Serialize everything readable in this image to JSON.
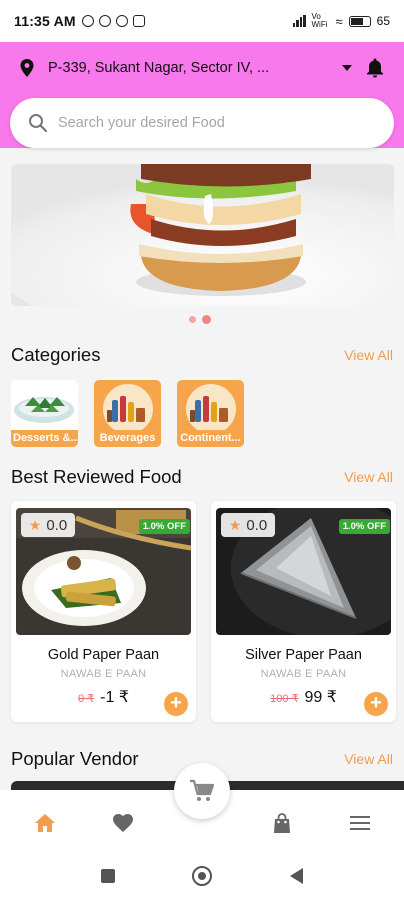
{
  "status_bar": {
    "time": "11:35 AM",
    "network": "Vo WiFi",
    "battery": "65"
  },
  "header": {
    "address": "P-339, Sukant Nagar, Sector IV, ...",
    "search_placeholder": "Search your desired  Food",
    "background_color": "#f879ec"
  },
  "banner": {
    "slide_count": 2,
    "active_index": 1
  },
  "categories": {
    "title": "Categories",
    "view_all": "View All",
    "items": [
      {
        "label": "Desserts &...",
        "icon": "dessert-plate-icon"
      },
      {
        "label": "Beverages",
        "icon": "bottles-icon"
      },
      {
        "label": "Continent...",
        "icon": "bottles-icon"
      }
    ]
  },
  "best_reviewed": {
    "title": "Best Reviewed Food",
    "view_all": "View All",
    "items": [
      {
        "rating": "0.0",
        "discount": "1.0% OFF",
        "name": "Gold Paper Paan",
        "vendor": "NAWAB E PAAN",
        "old_price": "0 ₹",
        "price": "-1 ₹"
      },
      {
        "rating": "0.0",
        "discount": "1.0% OFF",
        "name": "Silver Paper Paan",
        "vendor": "NAWAB E PAAN",
        "old_price": "100 ₹",
        "price": "99 ₹"
      }
    ]
  },
  "popular_vendor": {
    "title": "Popular Vendor",
    "view_all": "View All"
  },
  "bottom_nav": {
    "items": [
      "home-icon",
      "heart-icon",
      "cart-icon",
      "bag-icon",
      "menu-icon"
    ],
    "active_color": "#f29c4d",
    "inactive_color": "#666666"
  },
  "accent_color": "#f7a54b"
}
